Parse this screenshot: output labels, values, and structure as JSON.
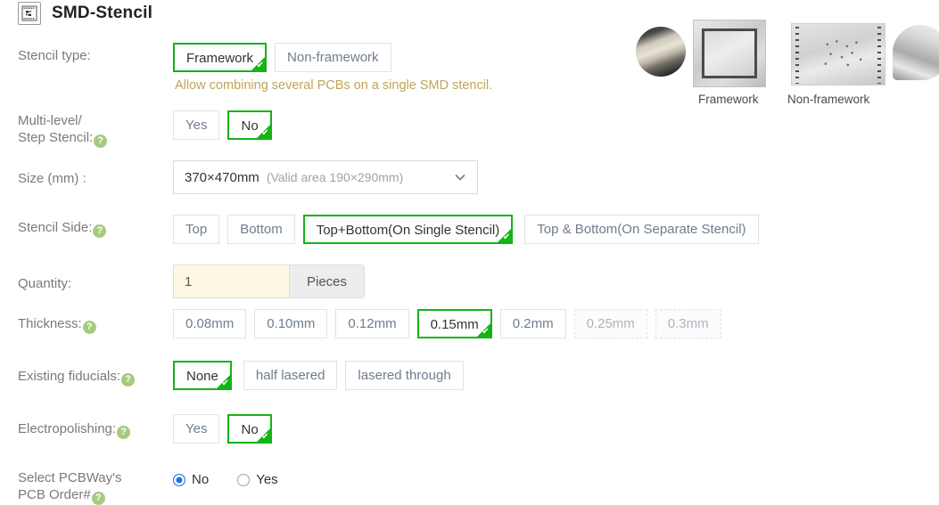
{
  "header": {
    "title": "SMD-Stencil",
    "icon": "stencil-icon"
  },
  "products": [
    {
      "caption": "Framework"
    },
    {
      "caption": "Non-framework"
    }
  ],
  "form": {
    "stencil_type": {
      "label": "Stencil type:",
      "options": [
        {
          "label": "Framework",
          "selected": true
        },
        {
          "label": "Non-framework",
          "selected": false
        }
      ],
      "hint": "Allow combining several PCBs on a single SMD stencil."
    },
    "multi_level": {
      "label_line1": "Multi-level/",
      "label_line2": "Step Stencil:",
      "help": "?",
      "options": [
        {
          "label": "Yes",
          "selected": false
        },
        {
          "label": "No",
          "selected": true
        }
      ]
    },
    "size": {
      "label": "Size (mm) :",
      "value": "370×470mm",
      "sub": "(Valid area 190×290mm)",
      "arrow": "chevron-down-icon"
    },
    "stencil_side": {
      "label": "Stencil Side:",
      "help": "?",
      "options": [
        {
          "label": "Top",
          "selected": false
        },
        {
          "label": "Bottom",
          "selected": false
        },
        {
          "label": "Top+Bottom(On Single Stencil)",
          "selected": true
        },
        {
          "label": "Top & Bottom(On Separate Stencil)",
          "selected": false
        }
      ]
    },
    "quantity": {
      "label": "Quantity:",
      "value": "1",
      "unit": "Pieces"
    },
    "thickness": {
      "label": "Thickness:",
      "help": "?",
      "options": [
        {
          "label": "0.08mm",
          "selected": false,
          "disabled": false
        },
        {
          "label": "0.10mm",
          "selected": false,
          "disabled": false
        },
        {
          "label": "0.12mm",
          "selected": false,
          "disabled": false
        },
        {
          "label": "0.15mm",
          "selected": true,
          "disabled": false
        },
        {
          "label": "0.2mm",
          "selected": false,
          "disabled": false
        },
        {
          "label": "0.25mm",
          "selected": false,
          "disabled": true
        },
        {
          "label": "0.3mm",
          "selected": false,
          "disabled": true
        }
      ]
    },
    "fiducials": {
      "label": "Existing fiducials:",
      "help": "?",
      "options": [
        {
          "label": "None",
          "selected": true
        },
        {
          "label": "half lasered",
          "selected": false
        },
        {
          "label": "lasered through",
          "selected": false
        }
      ]
    },
    "electropolishing": {
      "label": "Electropolishing:",
      "help": "?",
      "options": [
        {
          "label": "Yes",
          "selected": false
        },
        {
          "label": "No",
          "selected": true
        }
      ]
    },
    "pcb_order": {
      "label_line1": "Select PCBWay's",
      "label_line2": "PCB Order#",
      "help": "?",
      "radios": [
        {
          "label": "No",
          "selected": true
        },
        {
          "label": "Yes",
          "selected": false
        }
      ]
    }
  },
  "colors": {
    "selected_green": "#14b414",
    "hint_gold": "#bda659",
    "radio_blue": "#1a73e8",
    "help_green": "#a6ca7f",
    "quantity_bg": "#fdf8e3"
  }
}
